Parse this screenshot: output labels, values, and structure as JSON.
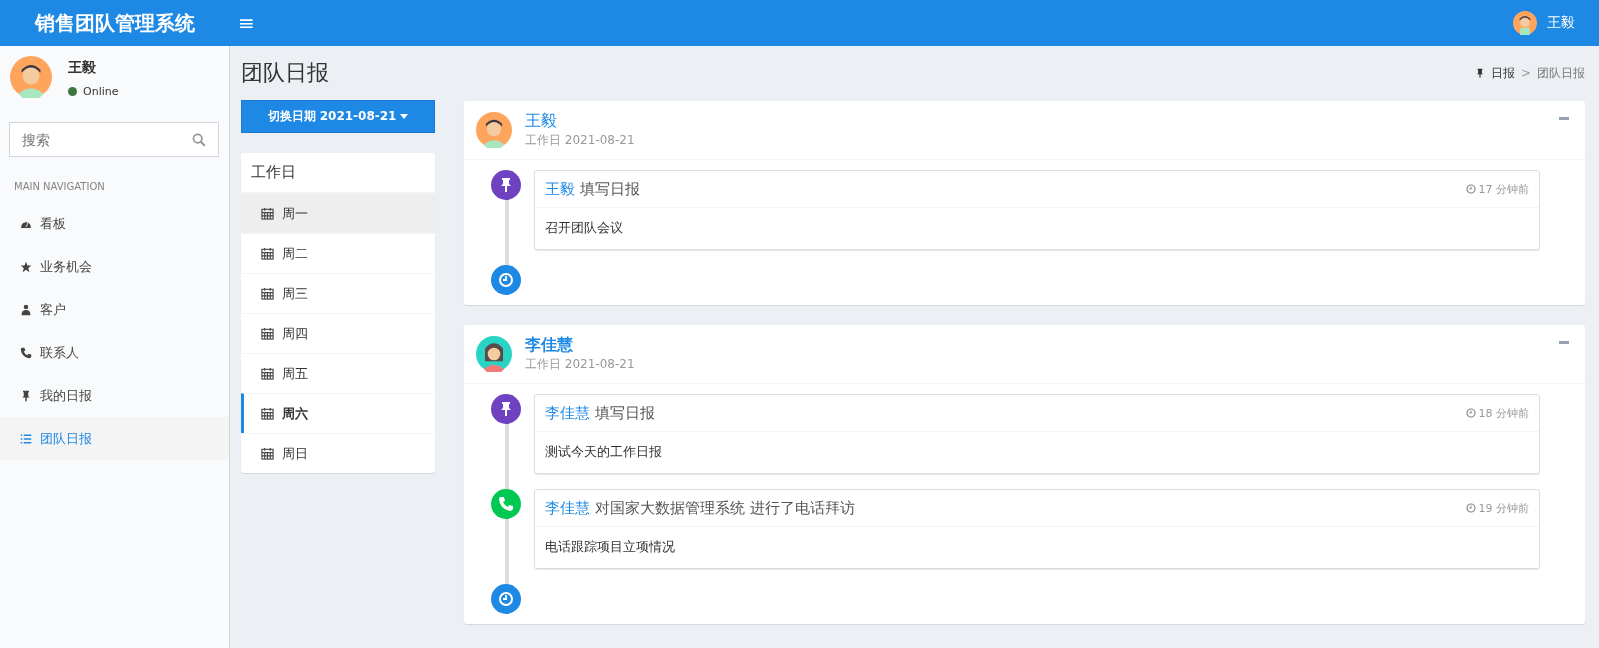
{
  "header": {
    "logo": "销售团队管理系统",
    "menu_glyph": "≡",
    "user_name": "王毅"
  },
  "sidebar": {
    "user": {
      "name": "王毅",
      "status": "Online"
    },
    "search": {
      "placeholder": "搜索"
    },
    "section_label": "MAIN NAVIGATION",
    "items": [
      {
        "label": "看板",
        "kind": "dashboard",
        "selected": false
      },
      {
        "label": "业务机会",
        "kind": "star",
        "selected": false
      },
      {
        "label": "客户",
        "kind": "people",
        "selected": false
      },
      {
        "label": "联系人",
        "kind": "phone",
        "selected": false
      },
      {
        "label": "我的日报",
        "kind": "pin",
        "selected": false
      },
      {
        "label": "团队日报",
        "kind": "list",
        "selected": true
      }
    ]
  },
  "page": {
    "title": "团队日报",
    "breadcrumb": [
      "日报",
      "团队日报"
    ],
    "breadcrumb_separator": ">"
  },
  "date_button": {
    "label": "切换日期 2021-08-21"
  },
  "weekdays": {
    "title": "工作日",
    "items": [
      {
        "label": "周一",
        "selected": false,
        "hovered": true
      },
      {
        "label": "周二",
        "selected": false,
        "hovered": false
      },
      {
        "label": "周三",
        "selected": false,
        "hovered": false
      },
      {
        "label": "周四",
        "selected": false,
        "hovered": false
      },
      {
        "label": "周五",
        "selected": false,
        "hovered": false
      },
      {
        "label": "周六",
        "selected": true,
        "hovered": false
      },
      {
        "label": "周日",
        "selected": false,
        "hovered": false
      }
    ]
  },
  "reports": [
    {
      "name": "王毅",
      "name_bold": false,
      "kind": "male",
      "subtitle": "工作日",
      "date": "2021-08-21",
      "entries": [
        {
          "kind": "pin",
          "color": "#6f42c1",
          "author": "王毅",
          "action": "填写日报",
          "time": "17 分钟前",
          "body": "召开团队会议"
        }
      ]
    },
    {
      "name": "李佳慧",
      "name_bold": true,
      "kind": "female",
      "subtitle": "工作日",
      "date": "2021-08-21",
      "entries": [
        {
          "kind": "pin",
          "color": "#6f42c1",
          "author": "李佳慧",
          "action": "填写日报",
          "time": "18 分钟前",
          "body": "测试今天的工作日报"
        },
        {
          "kind": "phone",
          "color": "#00c853",
          "author": "李佳慧",
          "action": "对国家大数据管理系统 进行了电话拜访",
          "time": "19 分钟前",
          "body": "电话跟踪项目立项情况"
        }
      ]
    }
  ]
}
